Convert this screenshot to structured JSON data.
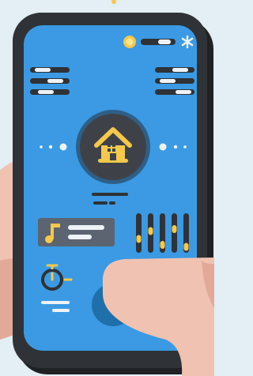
{
  "colors": {
    "background": "#e3eef5",
    "phone_body": "#2f3237",
    "screen": "#3b9ae3",
    "accent_yellow": "#f6c84b",
    "hand_skin": "#f0c2b2",
    "hand_shadow": "#e2a999",
    "home_circle": "#3e4248",
    "control_panel": "#5b6470",
    "light_stroke": "#eef3f7"
  },
  "icons": {
    "status_sun": "sun-icon",
    "status_toggle": "toggle-switch-icon",
    "status_snow": "snowflake-icon",
    "left_settings": "sliders-icon",
    "right_settings": "sliders-icon",
    "home_hub": "home-icon",
    "music": "music-note-icon",
    "equalizer": "equalizer-icon",
    "timer": "stopwatch-icon",
    "action_button": "round-button"
  },
  "equalizer_levels": [
    0.35,
    0.55,
    0.2,
    0.6,
    0.15
  ]
}
